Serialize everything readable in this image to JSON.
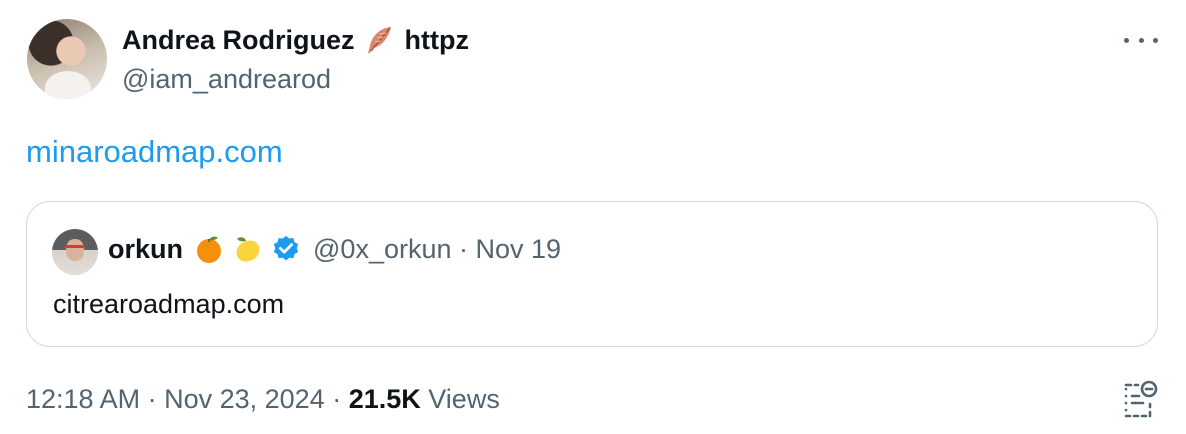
{
  "tweet": {
    "author": {
      "name": "Andrea Rodriguez",
      "name_suffix": "httpz",
      "handle": "@iam_andrearod",
      "badge_icon": "feather-icon"
    },
    "text_link": "minaroadmap.com",
    "quote": {
      "name": "orkun",
      "emojis": [
        "orange-emoji",
        "lemon-emoji"
      ],
      "verified": true,
      "meta": "@0x_orkun · Nov 19",
      "text": "citrearoadmap.com"
    },
    "footer": {
      "timestamp": "12:18 AM · Nov 23, 2024 ·",
      "views_count": "21.5K",
      "views_label": "Views"
    }
  },
  "colors": {
    "link": "#1d9bf0",
    "secondary_text": "#536471",
    "primary_text": "#0f1419",
    "border": "#cfd9de"
  }
}
